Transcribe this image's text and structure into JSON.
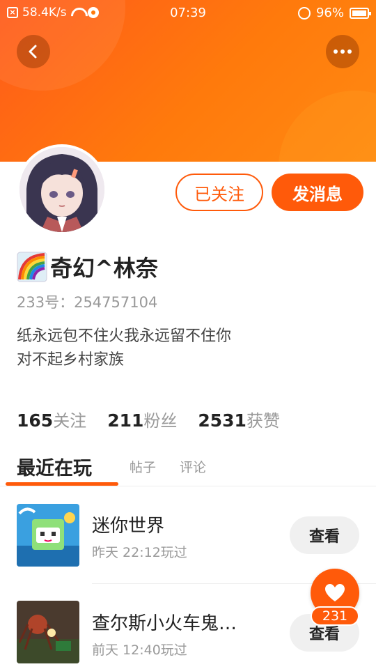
{
  "status_bar": {
    "net_speed": "58.4K/s",
    "time": "07:39",
    "battery": "96%"
  },
  "header": {
    "back_icon": "chevron-left-icon",
    "more_icon": "more-dots-icon"
  },
  "profile": {
    "name": "奇幻^林奈",
    "name_emoji": "rainbow",
    "id_label": "233号：254757104",
    "bio_lines": [
      "纸永远包不住火我永远留不住你",
      "对不起乡村家族"
    ],
    "follow_label": "已关注",
    "message_label": "发消息",
    "accent_color": "#ff5a0a"
  },
  "stats": [
    {
      "num": "165",
      "label": "关注"
    },
    {
      "num": "211",
      "label": "粉丝"
    },
    {
      "num": "2531",
      "label": "获赞"
    }
  ],
  "tabs": [
    {
      "label": "最近在玩",
      "active": true
    },
    {
      "label": "帖子",
      "active": false
    },
    {
      "label": "评论",
      "active": false
    }
  ],
  "games": [
    {
      "title": "迷你世界",
      "time": "昨天 22:12玩过",
      "button": "查看"
    },
    {
      "title": "查尔斯小火车鬼…",
      "time": "前天 12:40玩过",
      "button": "查看"
    }
  ],
  "like_float": {
    "icon": "heart-icon",
    "count": "231"
  }
}
